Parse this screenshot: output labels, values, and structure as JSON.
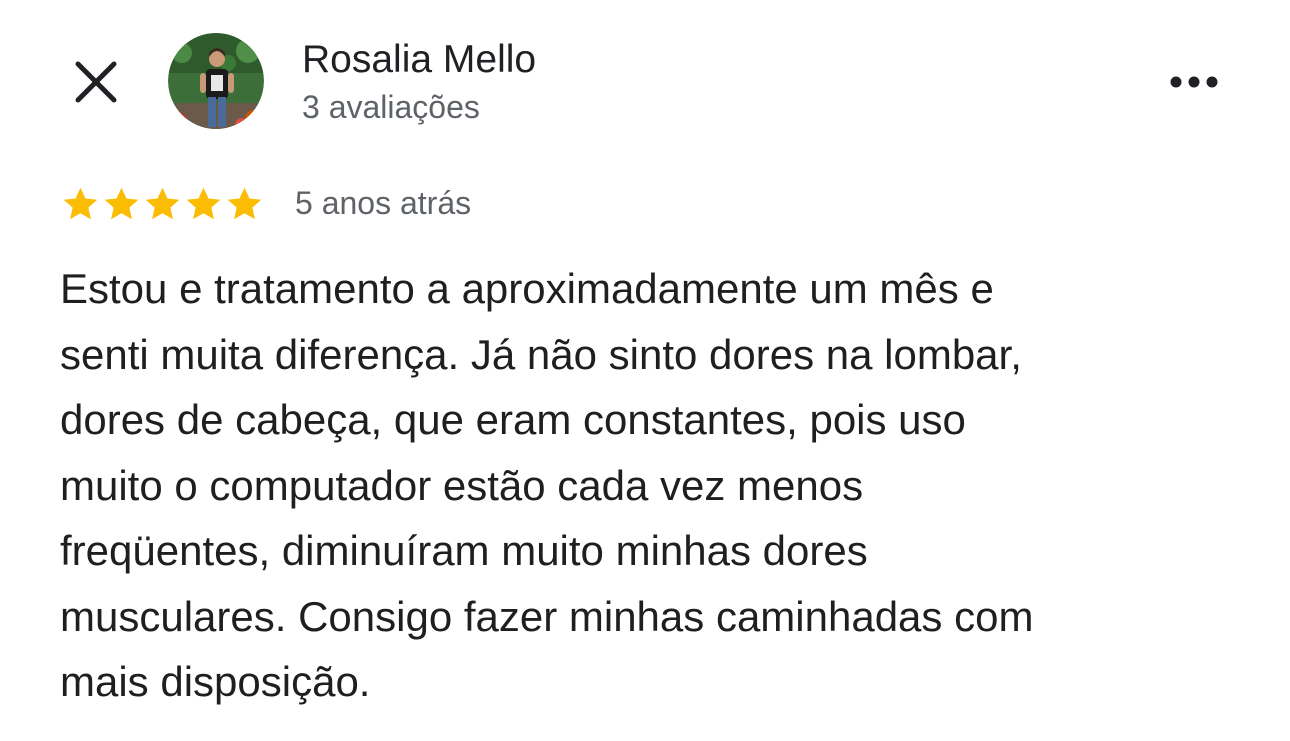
{
  "reviewer": {
    "name": "Rosalia Mello",
    "review_count": "3 avaliações"
  },
  "review": {
    "rating": 5,
    "rating_max": 5,
    "date": "5 anos atrás",
    "text_lines": [
      "Estou e tratamento a aproximadamente um mês e",
      "senti muita diferença. Já não sinto dores na lombar,",
      "dores de cabeça, que eram constantes, pois uso",
      "muito o computador estão cada vez menos",
      "freqüentes, diminuíram muito minhas dores",
      "musculares. Consigo fazer minhas caminhadas com",
      "mais disposição."
    ]
  },
  "icons": {
    "close": "close-icon",
    "more": "more-options-icon",
    "star": "star-icon"
  },
  "colors": {
    "star": "#FBBC04",
    "text_primary": "#1f1f1f",
    "text_secondary": "#5f6368"
  }
}
